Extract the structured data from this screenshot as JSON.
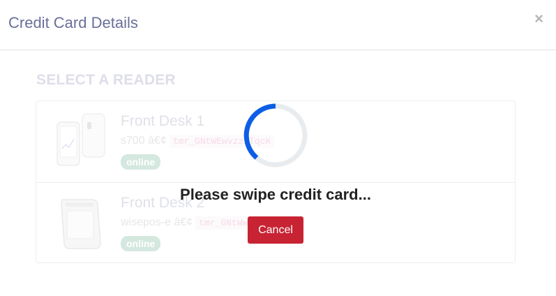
{
  "header": {
    "title": "Credit Card Details",
    "close_label": "×"
  },
  "section": {
    "heading": "SELECT A READER"
  },
  "readers": [
    {
      "name": "Front Desk 1",
      "model": "s700 â€¢",
      "serial": "tmr_GNtWEwvzzPTqcK",
      "status": "online",
      "device_icon": "smart-terminal-icon"
    },
    {
      "name": "Front Desk 2",
      "model": "wisepos-e â€¢",
      "serial": "tmr_GNtWwY2yTwf",
      "status": "online",
      "device_icon": "card-reader-icon"
    }
  ],
  "overlay": {
    "message": "Please swipe credit card...",
    "cancel_label": "Cancel"
  },
  "colors": {
    "spinner": "#0d5ee6",
    "spinner_track": "#e9ecef",
    "cancel": "#c82333",
    "badge": "#198754"
  }
}
